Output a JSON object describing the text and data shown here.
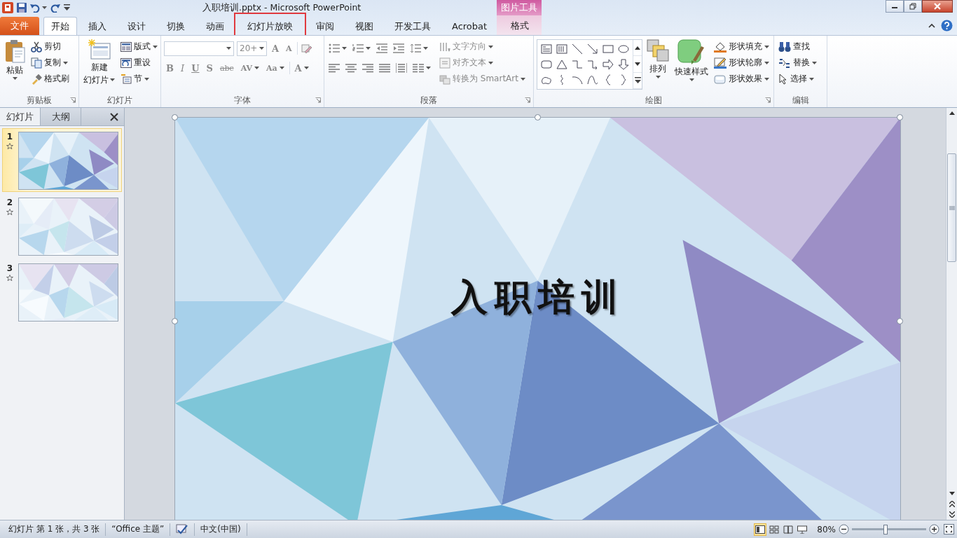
{
  "window": {
    "title": "入职培训.pptx  -  Microsoft PowerPoint"
  },
  "context_group": {
    "label": "图片工具"
  },
  "file_tab": {
    "label": "文件"
  },
  "tabs": [
    {
      "label": "开始",
      "selected": true,
      "highlighted": false,
      "contextual": false
    },
    {
      "label": "插入",
      "selected": false,
      "highlighted": false,
      "contextual": false
    },
    {
      "label": "设计",
      "selected": false,
      "highlighted": false,
      "contextual": false
    },
    {
      "label": "切换",
      "selected": false,
      "highlighted": false,
      "contextual": false
    },
    {
      "label": "动画",
      "selected": false,
      "highlighted": false,
      "contextual": false
    },
    {
      "label": "幻灯片放映",
      "selected": false,
      "highlighted": true,
      "contextual": false
    },
    {
      "label": "审阅",
      "selected": false,
      "highlighted": false,
      "contextual": false
    },
    {
      "label": "视图",
      "selected": false,
      "highlighted": false,
      "contextual": false
    },
    {
      "label": "开发工具",
      "selected": false,
      "highlighted": false,
      "contextual": false
    },
    {
      "label": "Acrobat",
      "selected": false,
      "highlighted": false,
      "contextual": false
    },
    {
      "label": "格式",
      "selected": false,
      "highlighted": false,
      "contextual": true
    }
  ],
  "clipboard": {
    "label": "剪贴板",
    "paste": "粘贴",
    "commands": [
      {
        "label": "剪切",
        "dropdown": false
      },
      {
        "label": "复制",
        "dropdown": true
      },
      {
        "label": "格式刷",
        "dropdown": false
      }
    ]
  },
  "slides_group": {
    "label": "幻灯片",
    "new_slide_line_1": "新建",
    "new_slide_line_2": "幻灯片",
    "commands": [
      {
        "label": "版式",
        "dropdown": true
      },
      {
        "label": "重设",
        "dropdown": false
      },
      {
        "label": "节",
        "dropdown": true
      }
    ]
  },
  "font": {
    "label": "字体",
    "disabled": true,
    "size": "20+",
    "size_buttons": [
      "A",
      "A"
    ],
    "format_buttons": [
      {
        "label": "B",
        "dropdown": false
      },
      {
        "label": "I",
        "dropdown": false
      },
      {
        "label": "U",
        "dropdown": false
      },
      {
        "label": "S",
        "dropdown": false
      },
      {
        "label": "abc",
        "dropdown": false
      },
      {
        "label": "AV",
        "dropdown": true
      },
      {
        "label": "Aa",
        "dropdown": true
      }
    ],
    "color_button": "A"
  },
  "paragraph": {
    "label": "段落",
    "disabled": true,
    "commands": [
      {
        "label": "文字方向"
      },
      {
        "label": "对齐文本"
      },
      {
        "label": "转换为 SmartArt"
      }
    ]
  },
  "drawing": {
    "label": "绘图",
    "arrange": "排列",
    "quick_styles": "快速样式",
    "commands": [
      "形状填充",
      "形状轮廓",
      "形状效果"
    ]
  },
  "editing": {
    "label": "编辑",
    "commands": [
      {
        "label": "查找",
        "dropdown": false
      },
      {
        "label": "替换",
        "dropdown": true
      },
      {
        "label": "选择",
        "dropdown": true
      }
    ]
  },
  "panel": {
    "tabs": [
      {
        "label": "幻灯片",
        "selected": true
      },
      {
        "label": "大纲",
        "selected": false
      }
    ]
  },
  "slides": [
    {
      "number": "1",
      "selected": true
    },
    {
      "number": "2",
      "selected": false
    },
    {
      "number": "3",
      "selected": false
    }
  ],
  "slide": {
    "title": "入职培训"
  },
  "status_bar": {
    "slide_info": "幻灯片 第 1 张，共 3 张",
    "theme": "“Office 主题”",
    "language": "中文(中国)",
    "views": [
      {
        "kind": "normal",
        "selected": true
      },
      {
        "kind": "sorter",
        "selected": false
      },
      {
        "kind": "reading",
        "selected": false
      },
      {
        "kind": "slideshow",
        "selected": false
      }
    ],
    "zoom": "80%",
    "zoom_slider": {
      "level": 0.45
    }
  }
}
